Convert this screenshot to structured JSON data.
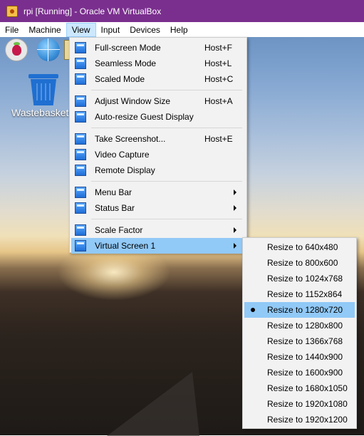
{
  "window": {
    "title": "rpi [Running] - Oracle VM VirtualBox"
  },
  "menubar": {
    "items": [
      "File",
      "Machine",
      "View",
      "Input",
      "Devices",
      "Help"
    ],
    "active": "View"
  },
  "desktop": {
    "icons": [
      {
        "label": "Wastebasket",
        "icon": "wastebasket-icon"
      }
    ]
  },
  "view_menu": {
    "items": [
      {
        "label": "Full-screen Mode",
        "shortcut": "Host+F",
        "icon": "fullscreen-icon"
      },
      {
        "label": "Seamless Mode",
        "shortcut": "Host+L",
        "icon": "seamless-icon"
      },
      {
        "label": "Scaled Mode",
        "shortcut": "Host+C",
        "icon": "scaled-icon"
      },
      {
        "label": "Adjust Window Size",
        "shortcut": "Host+A",
        "icon": "adjust-window-icon"
      },
      {
        "label": "Auto-resize Guest Display",
        "shortcut": "",
        "icon": "auto-resize-icon"
      },
      {
        "label": "Take Screenshot...",
        "shortcut": "Host+E",
        "icon": "screenshot-icon"
      },
      {
        "label": "Video Capture",
        "shortcut": "",
        "icon": "video-capture-icon"
      },
      {
        "label": "Remote Display",
        "shortcut": "",
        "icon": "remote-display-icon"
      },
      {
        "label": "Menu Bar",
        "shortcut": "",
        "icon": "menu-bar-icon",
        "submenu": true
      },
      {
        "label": "Status Bar",
        "shortcut": "",
        "icon": "status-bar-icon",
        "submenu": true
      },
      {
        "label": "Scale Factor",
        "shortcut": "",
        "icon": "scale-factor-icon",
        "submenu": true
      },
      {
        "label": "Virtual Screen 1",
        "shortcut": "",
        "icon": "virtual-screen-icon",
        "submenu": true,
        "highlighted": true
      }
    ]
  },
  "virtual_screen_submenu": {
    "items": [
      "Resize to 640x480",
      "Resize to 800x600",
      "Resize to 1024x768",
      "Resize to 1152x864",
      "Resize to 1280x720",
      "Resize to 1280x800",
      "Resize to 1366x768",
      "Resize to 1440x900",
      "Resize to 1600x900",
      "Resize to 1680x1050",
      "Resize to 1920x1080",
      "Resize to 1920x1200"
    ],
    "selected": "Resize to 1280x720"
  }
}
